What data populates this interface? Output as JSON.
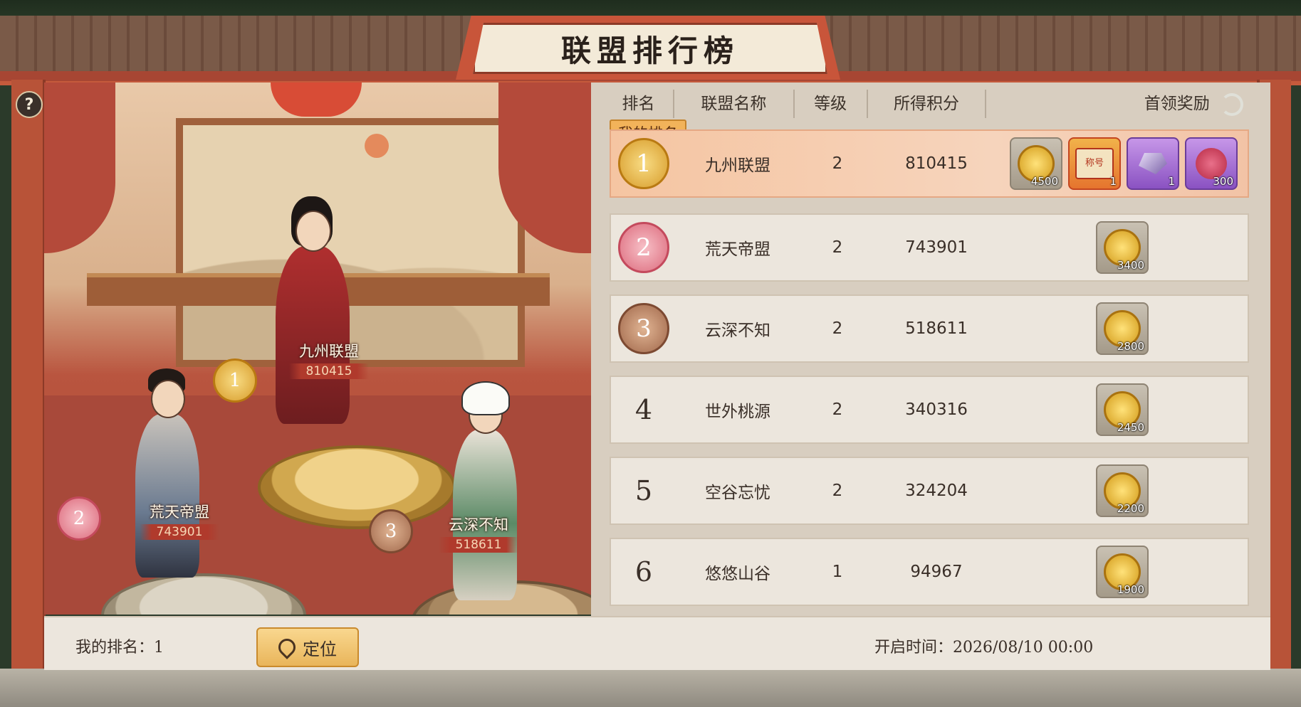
{
  "title": "联盟排行榜",
  "help_glyph": "?",
  "podium": [
    {
      "rank": "1",
      "name": "九州联盟",
      "score": "810415"
    },
    {
      "rank": "2",
      "name": "荒天帝盟",
      "score": "743901"
    },
    {
      "rank": "3",
      "name": "云深不知",
      "score": "518611"
    }
  ],
  "table": {
    "headers": {
      "rank": "排名",
      "name": "联盟名称",
      "level": "等级",
      "score": "所得积分",
      "reward": "首领奖励"
    },
    "my_tag": "我的排名",
    "rows": [
      {
        "rank": "1",
        "name": "九州联盟",
        "level": "2",
        "score": "810415",
        "rewards": [
          {
            "type": "coin",
            "qty": "4500"
          },
          {
            "type": "title",
            "label": "称号",
            "qty": "1"
          },
          {
            "type": "gem",
            "qty": "1"
          },
          {
            "type": "seal",
            "qty": "300"
          }
        ]
      },
      {
        "rank": "2",
        "name": "荒天帝盟",
        "level": "2",
        "score": "743901",
        "rewards": [
          {
            "type": "coin",
            "qty": "3400"
          }
        ]
      },
      {
        "rank": "3",
        "name": "云深不知",
        "level": "2",
        "score": "518611",
        "rewards": [
          {
            "type": "coin",
            "qty": "2800"
          }
        ]
      },
      {
        "rank": "4",
        "name": "世外桃源",
        "level": "2",
        "score": "340316",
        "rewards": [
          {
            "type": "coin",
            "qty": "2450"
          }
        ]
      },
      {
        "rank": "5",
        "name": "空谷忘忧",
        "level": "2",
        "score": "324204",
        "rewards": [
          {
            "type": "coin",
            "qty": "2200"
          }
        ]
      },
      {
        "rank": "6",
        "name": "悠悠山谷",
        "level": "1",
        "score": "94967",
        "rewards": [
          {
            "type": "coin",
            "qty": "1900"
          }
        ]
      }
    ]
  },
  "bottom": {
    "my_rank": "我的排名：1",
    "locate_label": "定位",
    "open_time": "开启时间：2026/08/10 00:00"
  },
  "colors": {
    "accent": "#c8553a",
    "mine_row": "#f6d4bc",
    "gold": "#d79b2a"
  }
}
